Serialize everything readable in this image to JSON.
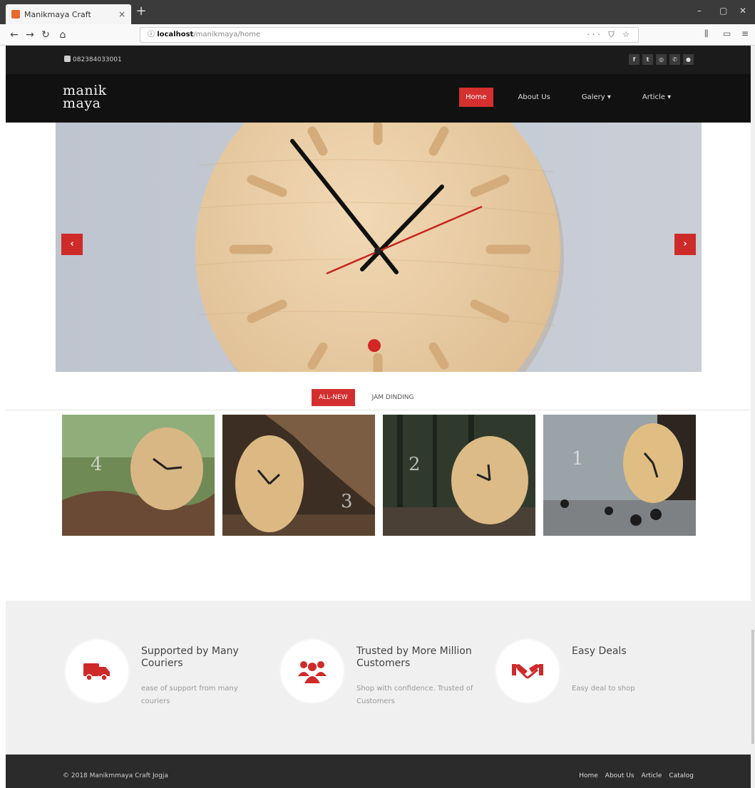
{
  "browser": {
    "tab_title": "Manikmaya Craft",
    "tab_close": "×",
    "new_tab": "+",
    "url_host": "localhost",
    "url_path": "/manikmaya/home",
    "url_actions": "··· ⛉ ☆",
    "window_controls": [
      "–",
      "▢",
      "✕"
    ]
  },
  "topbar": {
    "phone": "082384033001",
    "socials": [
      {
        "icon": "facebook-icon",
        "glyph": "f"
      },
      {
        "icon": "twitter-icon",
        "glyph": "t"
      },
      {
        "icon": "instagram-icon",
        "glyph": "◎"
      },
      {
        "icon": "whatsapp-icon",
        "glyph": "✆"
      },
      {
        "icon": "email-icon",
        "glyph": "●"
      }
    ]
  },
  "navbar": {
    "logo_line1": "manik",
    "logo_line2": "maya",
    "menu": [
      {
        "label": "Home",
        "active": true
      },
      {
        "label": "About Us",
        "active": false
      },
      {
        "label": "Galery ▾",
        "active": false
      },
      {
        "label": "Article ▾",
        "active": false
      }
    ]
  },
  "slider": {
    "prev": "‹",
    "next": "›"
  },
  "filter_tabs": [
    "ALL-NEW",
    "JAM DINDING"
  ],
  "features": [
    {
      "icon": "truck-icon",
      "title": "Supported by Many Couriers",
      "desc": "ease of support from many couriers"
    },
    {
      "icon": "users-icon",
      "title": "Trusted by More Million Customers",
      "desc": "Shop with confidence. Trusted of Customers"
    },
    {
      "icon": "handshake-icon",
      "title": "Easy Deals",
      "desc": "Easy deal to shop"
    }
  ],
  "footer": {
    "copyright": "© 2018 Manikmmaya Craft Jogja",
    "links": [
      "Home",
      "About Us",
      "Article",
      "Catalog"
    ]
  },
  "colors": {
    "accent": "#d32f2f",
    "topbar": "#1b1b1b",
    "navbar": "#111111",
    "footer": "#2b2b2b",
    "features_bg": "#f0f0f0"
  }
}
